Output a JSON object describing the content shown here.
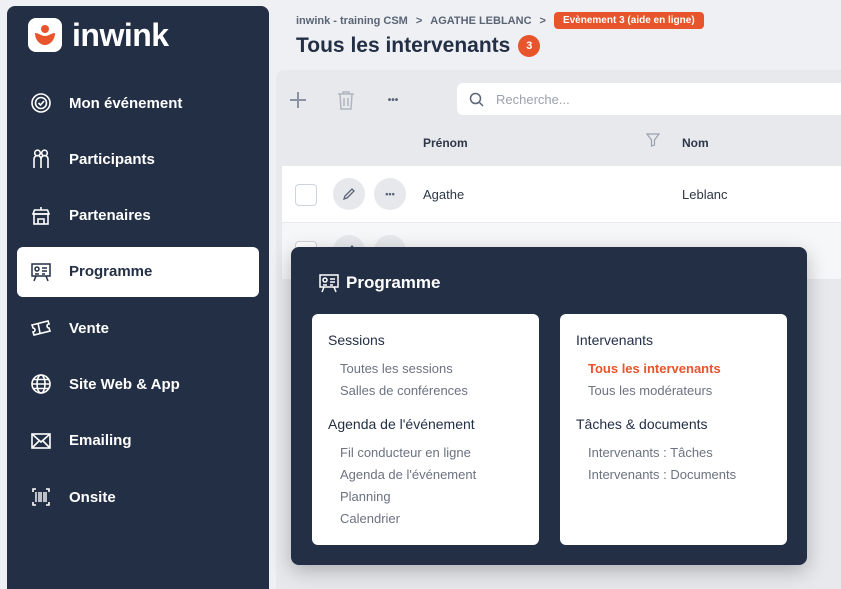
{
  "app": {
    "name": "inwink"
  },
  "sidebar": {
    "items": [
      {
        "label": "Mon événement",
        "icon": "badge-check-icon"
      },
      {
        "label": "Participants",
        "icon": "users-icon"
      },
      {
        "label": "Partenaires",
        "icon": "booth-icon"
      },
      {
        "label": "Programme",
        "icon": "presentation-board-icon",
        "active": true
      },
      {
        "label": "Vente",
        "icon": "tickets-icon"
      },
      {
        "label": "Site Web & App",
        "icon": "globe-icon"
      },
      {
        "label": "Emailing",
        "icon": "envelope-icon"
      },
      {
        "label": "Onsite",
        "icon": "barcode-icon"
      }
    ]
  },
  "header": {
    "breadcrumb": [
      "inwink - training CSM",
      "AGATHE LEBLANC"
    ],
    "breadcrumb_separator": ">",
    "event_badge": "Evènement 3 (aide en ligne)",
    "title": "Tous les intervenants",
    "count": "3"
  },
  "toolbar": {
    "search_placeholder": "Recherche...",
    "more_label": "•••"
  },
  "table": {
    "columns": [
      "Prénom",
      "Nom"
    ],
    "rows": [
      {
        "prenom": "Agathe",
        "nom": "Leblanc"
      }
    ],
    "more_label": "•••"
  },
  "menu": {
    "title": "Programme",
    "columns": [
      {
        "sections": [
          {
            "heading": "Sessions",
            "links": [
              "Toutes les sessions",
              "Salles de conférences"
            ]
          },
          {
            "heading": "Agenda de l'événement",
            "links": [
              "Fil conducteur en ligne",
              "Agenda de l'événement",
              "Planning",
              "Calendrier"
            ]
          }
        ]
      },
      {
        "sections": [
          {
            "heading": "Intervenants",
            "links": [
              "Tous les intervenants",
              "Tous les modérateurs"
            ]
          },
          {
            "heading": "Tâches & documents",
            "links": [
              "Intervenants : Tâches",
              "Intervenants : Documents"
            ]
          }
        ]
      }
    ],
    "current_link": "Tous les intervenants"
  },
  "colors": {
    "sidebar_bg": "#232f45",
    "accent": "#e8542b",
    "panel_bg": "#e7e9ed"
  }
}
